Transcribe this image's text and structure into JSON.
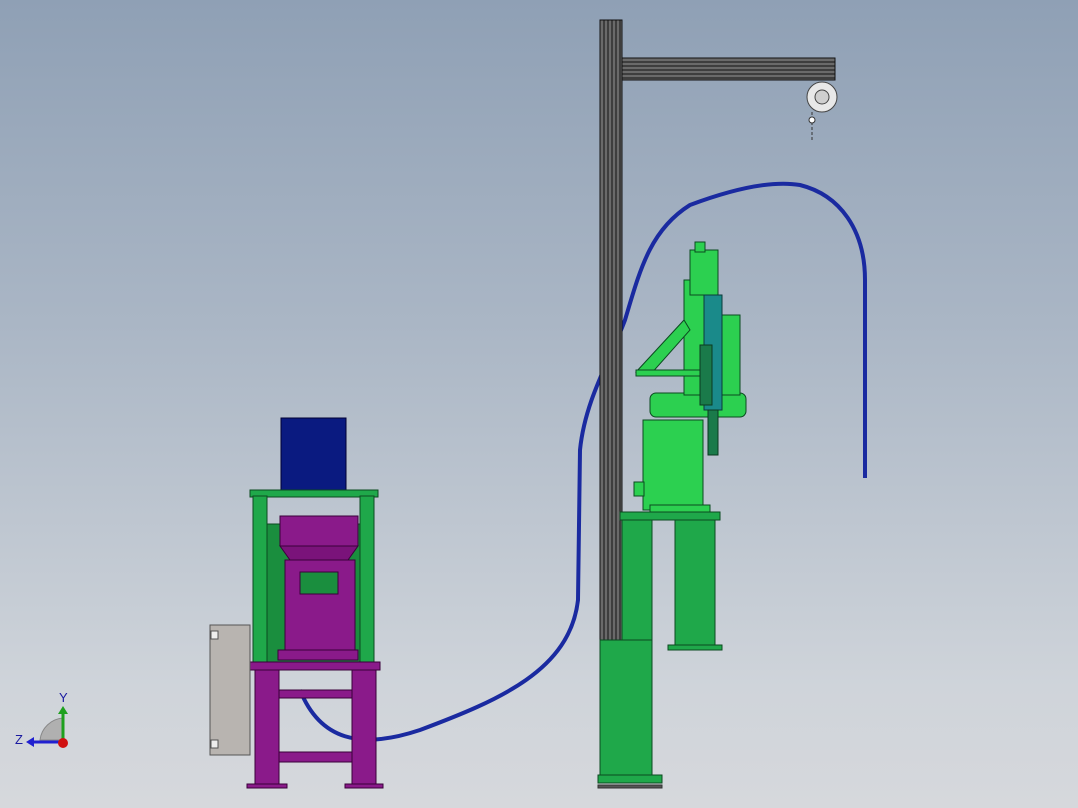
{
  "viewport": {
    "background_top": "#8fa0b5",
    "background_bottom": "#d6d8dc"
  },
  "triad": {
    "y_label": "Y",
    "z_label": "Z",
    "y_color": "#1ea01e",
    "z_color": "#2020d0",
    "x_color": "#d01010"
  },
  "colors": {
    "frame_green": "#1fa84a",
    "robot_green": "#2cd050",
    "press_purple": "#8a1a8a",
    "motor_blue": "#0a1a80",
    "hose_blue": "#1a2aa0",
    "cabinet_gray": "#b8b4b0",
    "column_dark": "#3a3a3a"
  },
  "icons": {
    "hoist": "balancer-hoist-icon",
    "triad": "axis-triad-icon"
  }
}
